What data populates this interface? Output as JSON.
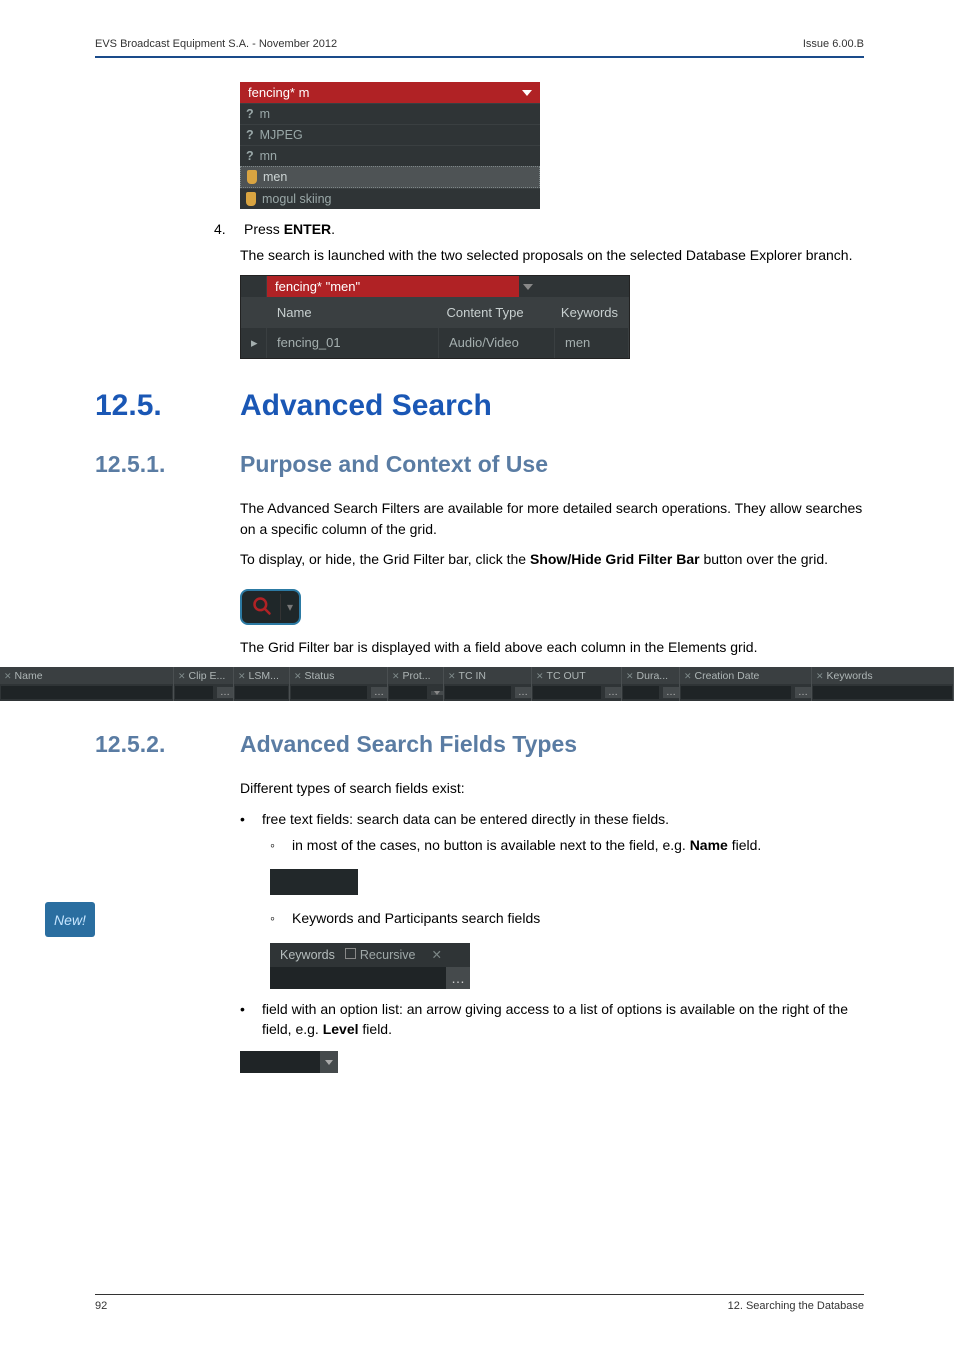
{
  "header": {
    "left": "EVS Broadcast Equipment S.A. - November 2012",
    "right": "Issue 6.00.B"
  },
  "autocomplete": {
    "input": "fencing* m",
    "items": [
      {
        "icon": "q",
        "label": "m"
      },
      {
        "icon": "q",
        "label": "MJPEG"
      },
      {
        "icon": "q",
        "label": "mn"
      },
      {
        "icon": "tag",
        "label": "men",
        "selected": true
      },
      {
        "icon": "tag",
        "label": "mogul skiing"
      }
    ]
  },
  "step4": {
    "num": "4.",
    "line1_a": "Press ",
    "line1_b": "ENTER",
    "line1_c": ".",
    "para": "The search is launched with the two selected proposals on the selected Database Explorer branch."
  },
  "results": {
    "query": "fencing* \"men\"",
    "head": {
      "name": "Name",
      "ct": "Content Type",
      "kw": "Keywords"
    },
    "row": {
      "name": "fencing_01",
      "ct": "Audio/Video",
      "kw": "men"
    }
  },
  "sec125": {
    "num": "12.5.",
    "title": "Advanced Search"
  },
  "sec1251": {
    "num": "12.5.1.",
    "title": "Purpose and Context of Use",
    "p1": "The Advanced Search Filters are available for more detailed search operations. They allow searches on a specific column of the grid.",
    "p2a": "To display, or hide, the Grid Filter bar, click the ",
    "p2b": "Show/Hide Grid Filter Bar",
    "p2c": " button over the grid.",
    "p3": "The Grid Filter bar is displayed with a field above each column in the Elements grid."
  },
  "filterbar": {
    "cols": [
      "Name",
      "Clip E...",
      "LSM...",
      "Status",
      "Prot...",
      "TC IN",
      "TC OUT",
      "Dura...",
      "Creation Date",
      "Keywords"
    ]
  },
  "sec1252": {
    "num": "12.5.2.",
    "title": "Advanced Search Fields Types",
    "intro": "Different types of search fields exist:",
    "b1": "free text fields: search data can be entered directly in these fields.",
    "s1a": "in most of the cases, no button is available next to the field, e.g. ",
    "s1b": "Name",
    "s1c": " field.",
    "s2": "Keywords and Participants search fields",
    "kwbox": {
      "label": "Keywords",
      "rec": "Recursive"
    },
    "b2a": "field with an option list: an arrow giving access to a list of options is available on the right of the field, e.g. ",
    "b2b": "Level",
    "b2c": " field."
  },
  "newbadge": "New!",
  "footer": {
    "left": "92",
    "right": "12. Searching the Database"
  }
}
